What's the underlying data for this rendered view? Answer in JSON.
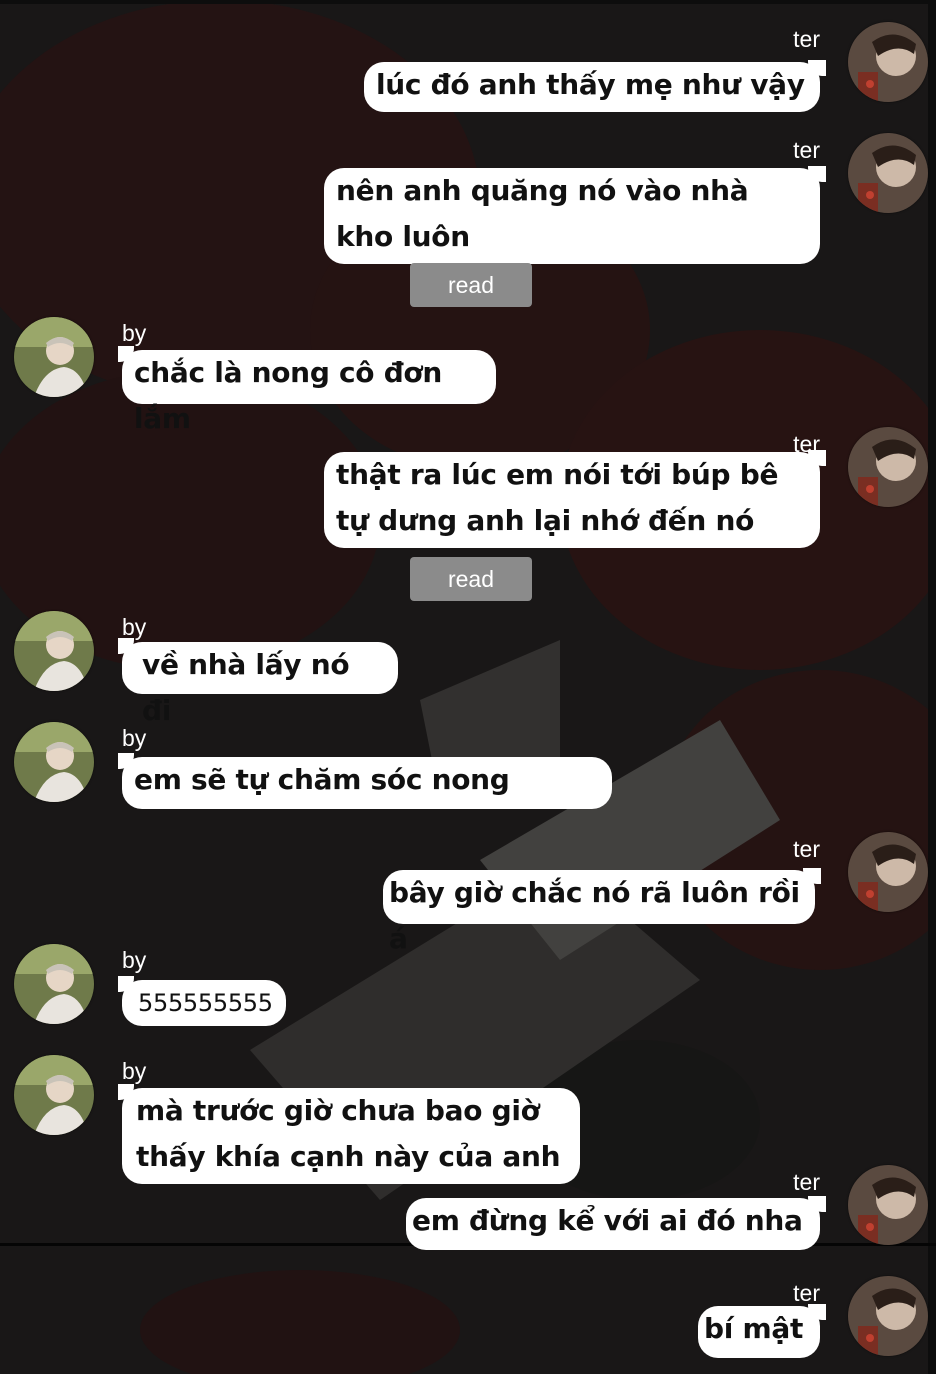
{
  "names": {
    "right": "ter",
    "left": "by"
  },
  "read_label": "read",
  "messages": [
    {
      "text": "lúc đó anh thấy mẹ như vậy"
    },
    {
      "text": "nên anh quăng nó vào nhà kho luôn"
    },
    {
      "text": "chắc là nong cô đơn lắm"
    },
    {
      "text": "thật ra lúc em nói tới búp bê tự dưng anh lại nhớ đến nó"
    },
    {
      "text": "về nhà lấy nó đi"
    },
    {
      "text": "em sẽ tự chăm sóc nong"
    },
    {
      "text": "bây giờ chắc nó rã luôn rồi á"
    },
    {
      "text": "555555555"
    },
    {
      "text": "mà trước giờ chưa bao giờ thấy khía cạnh này của anh"
    },
    {
      "text": "em đừng kể với ai đó nha"
    },
    {
      "text": "bí mật"
    }
  ],
  "colors": {
    "bubble": "#ffffff",
    "read_badge": "#8b8b8b",
    "background": "#1c1a1a"
  }
}
